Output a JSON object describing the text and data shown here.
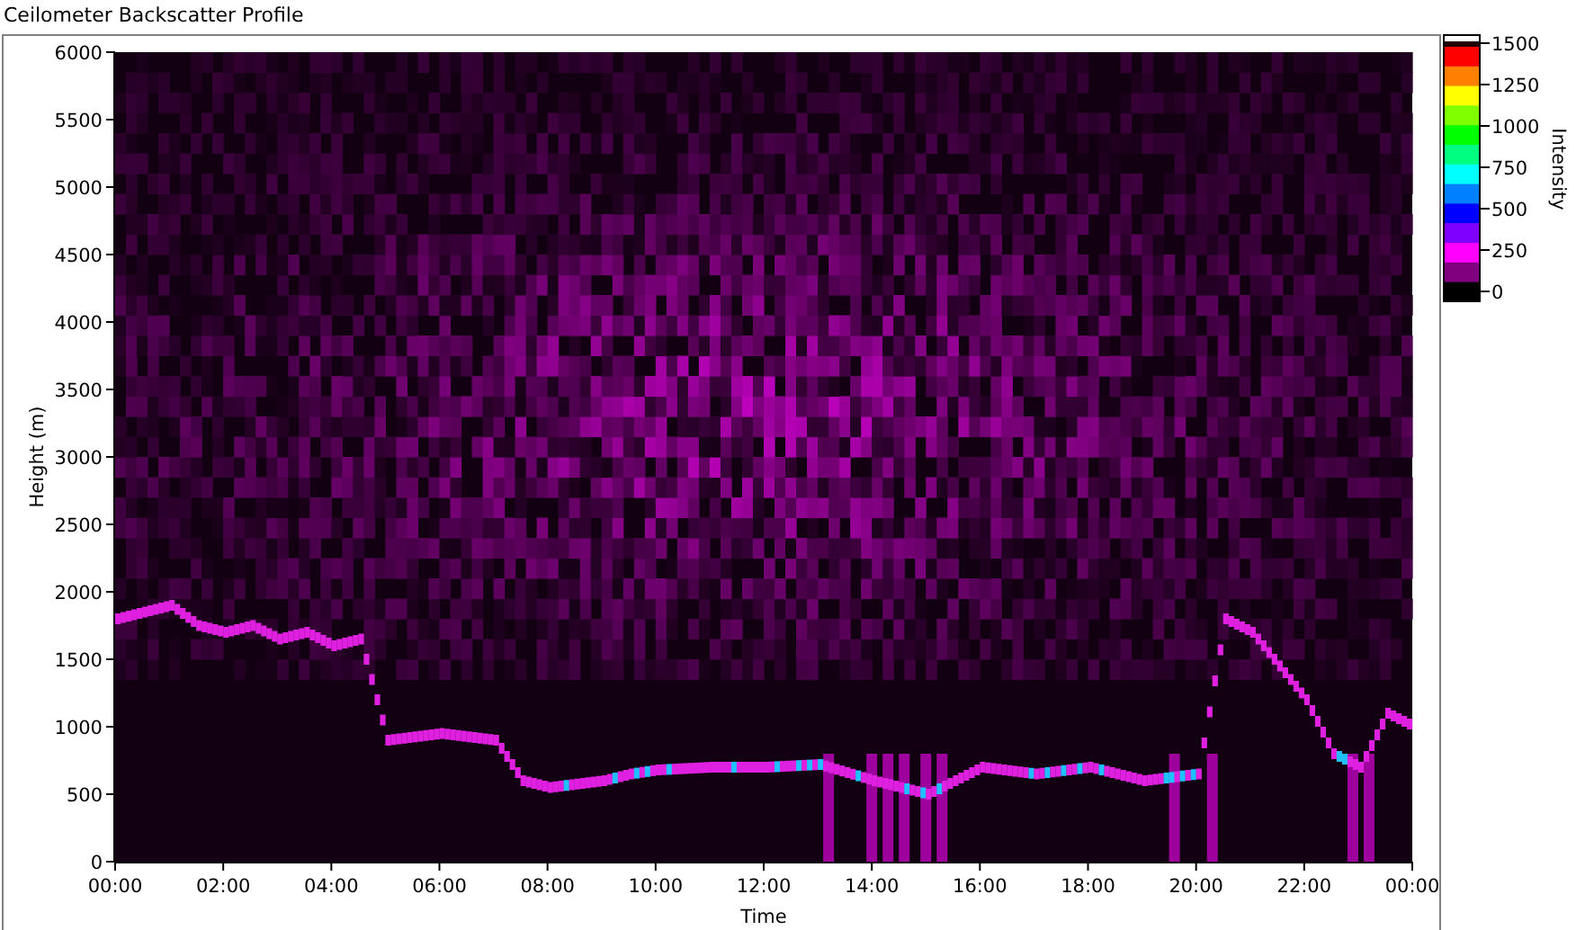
{
  "title": "Ceilometer Backscatter Profile",
  "y_axis": {
    "label": "Height (m)",
    "ticks": [
      "6000",
      "5500",
      "5000",
      "4500",
      "4000",
      "3500",
      "3000",
      "2500",
      "2000",
      "1500",
      "1000",
      "500",
      "0"
    ]
  },
  "x_axis": {
    "label": "Time",
    "ticks": [
      "00:00",
      "02:00",
      "04:00",
      "06:00",
      "08:00",
      "10:00",
      "12:00",
      "14:00",
      "16:00",
      "18:00",
      "20:00",
      "22:00",
      "00:00"
    ]
  },
  "color_scale": {
    "label": "Intensity",
    "ticks": [
      "1500",
      "1250",
      "1000",
      "750",
      "500",
      "250",
      "0"
    ]
  }
}
